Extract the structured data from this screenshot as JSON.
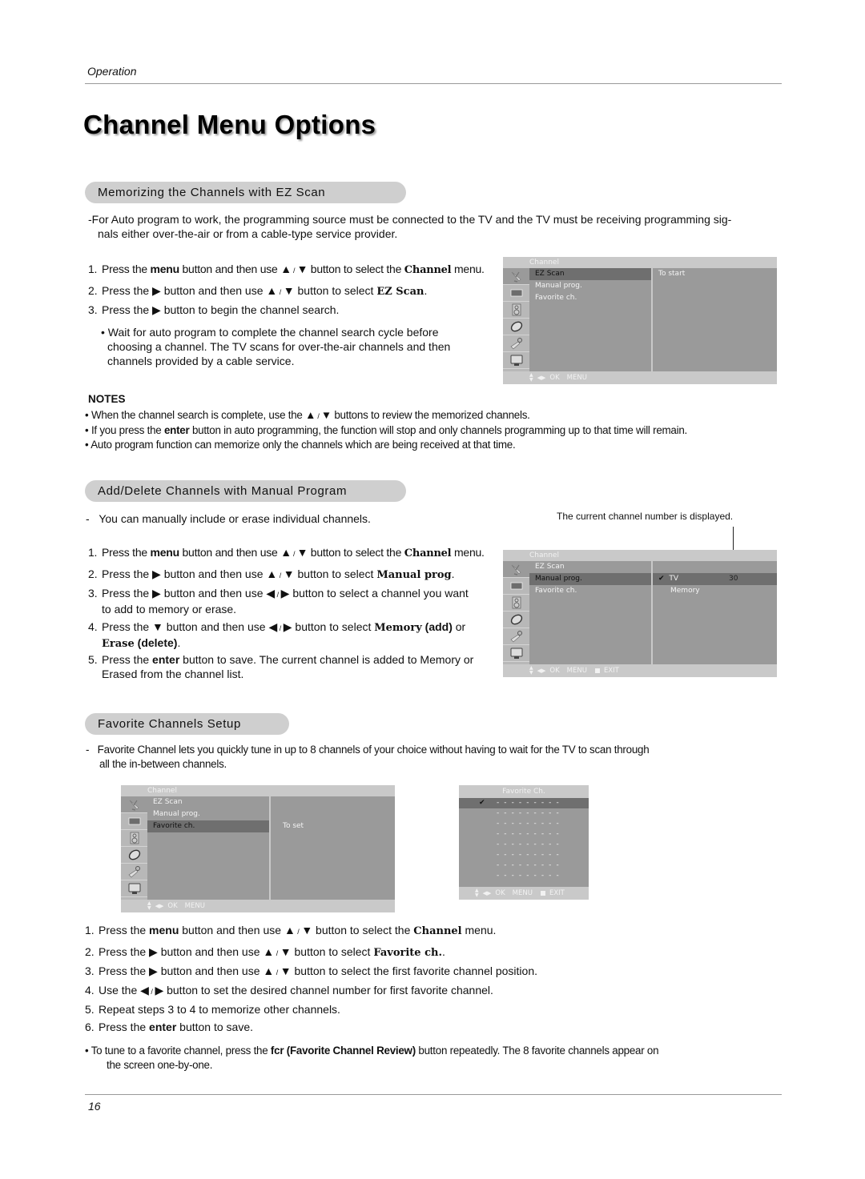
{
  "header": {
    "section_label": "Operation",
    "page_title": "Channel Menu Options"
  },
  "symbols": {
    "up": "▲",
    "down": "▼",
    "left": "◀",
    "right": "▶",
    "slash": " / ",
    "check": "✔",
    "bullet": "•",
    "dash": "-"
  },
  "ez_scan": {
    "heading": "Memorizing the Channels with EZ Scan",
    "intro": "For Auto program to work, the programming source must be connected to the TV and the TV must be receiving programming sig-",
    "intro_cont": "nals either over-the-air or from a cable-type service provider.",
    "steps": [
      {
        "num": "1.",
        "pre": "Press the ",
        "b1": "menu",
        "mid": " button and then use ",
        "post": " button to select the ",
        "b2": "Channel",
        "end": " menu."
      },
      {
        "num": "2.",
        "pre": "Press the ",
        "mid": " button and then use ",
        "post": " button to select ",
        "b2": "EZ Scan",
        "end": "."
      },
      {
        "num": "3.",
        "pre": "Press the ",
        "post": " button to begin the channel search."
      }
    ],
    "bullet": "Wait for auto program to complete the channel search cycle before choosing a channel. The TV scans for over-the-air channels and then channels provided by a cable service.",
    "osd": {
      "title": "Channel",
      "items": [
        "EZ Scan",
        "Manual prog.",
        "Favorite ch."
      ],
      "selected_index": 0,
      "sub_text": "To start",
      "footer": [
        "OK",
        "MENU"
      ]
    }
  },
  "notes": {
    "heading": "NOTES",
    "items": [
      {
        "pre": "When the channel search is complete, use the ",
        "post": " buttons to review the memorized channels."
      },
      {
        "pre": "If you press the ",
        "b": "enter",
        "post": " button in auto programming, the function will stop and only channels programming up to that time will remain."
      },
      {
        "pre": "Auto program function can memorize only the channels which are being received at that time."
      }
    ]
  },
  "manual_prog": {
    "heading": "Add/Delete Channels with Manual Program",
    "intro": "You can manually include or erase individual channels.",
    "callout": "The current channel number is displayed.",
    "steps": [
      {
        "num": "1.",
        "pre": "Press the ",
        "b1": "menu",
        "mid": " button and then use ",
        "post": " button to select the ",
        "b2": "Channel",
        "end": " menu."
      },
      {
        "num": "2.",
        "pre": "Press the ",
        "mid": " button and then use ",
        "post": " button to select ",
        "b2": "Manual prog",
        "end": "."
      },
      {
        "num": "3.",
        "pre": "Press the ",
        "mid": " button and then use ",
        "post": " button to select a channel you want",
        "cont": "to add to memory or erase."
      },
      {
        "num": "4.",
        "pre": "Press the ",
        "mid": " button and then use ",
        "post": " button to select ",
        "b2": "Memory",
        "b3": " (add)",
        "end": " or",
        "cont_b1": "Erase",
        "cont_b2": " (delete)",
        "cont_end": "."
      },
      {
        "num": "5.",
        "pre": "Press the ",
        "b1": "enter",
        "post": " button to save. The current channel is added to Memory or",
        "cont": "Erased from the channel list."
      }
    ],
    "osd": {
      "title": "Channel",
      "items": [
        "EZ Scan",
        "Manual prog.",
        "Favorite ch."
      ],
      "selected_index": 1,
      "sub_rows": [
        {
          "check": "✔",
          "label": "TV",
          "value": "30"
        },
        {
          "label": "Memory"
        }
      ],
      "footer": [
        "OK",
        "MENU",
        "EXIT"
      ]
    }
  },
  "favorite": {
    "heading": "Favorite Channels Setup",
    "intro": "Favorite Channel lets you quickly tune in up to 8 channels of your choice without having to wait for the TV to scan through",
    "intro_cont": "all the in-between channels.",
    "osd": {
      "title": "Channel",
      "items": [
        "EZ Scan",
        "Manual prog.",
        "Favorite ch."
      ],
      "selected_index": 2,
      "sub_text": "To set",
      "footer": [
        "OK",
        "MENU"
      ]
    },
    "fav_osd": {
      "title": "Favorite Ch.",
      "slots": [
        "- - - - - - - - -",
        "- - - - - - - - -",
        "- - - - - - - - -",
        "- - - - - - - - -",
        "- - - - - - - - -",
        "- - - - - - - - -",
        "- - - - - - - - -",
        "- - - - - - - - -"
      ],
      "selected_index": 0,
      "footer": [
        "OK",
        "MENU",
        "EXIT"
      ]
    },
    "steps": [
      {
        "num": "1.",
        "pre": "Press the ",
        "b1": "menu",
        "mid": " button and then use ",
        "post": "  button to select the ",
        "b2": "Channel",
        "end": " menu."
      },
      {
        "num": "2.",
        "pre": "Press the ",
        "mid": "  button and then use ",
        "post": " button to select ",
        "b2": "Favorite ch.",
        "end": "."
      },
      {
        "num": "3.",
        "pre": "Press the ",
        "mid": " button and then use ",
        "post": " button to select the first favorite channel position."
      },
      {
        "num": "4.",
        "pre": "Use the ",
        "post": " button to set the desired channel number for first favorite channel."
      },
      {
        "num": "5.",
        "pre": "Repeat steps 3 to 4 to memorize other channels."
      },
      {
        "num": "6.",
        "pre": "Press the ",
        "b1": "enter",
        "post": " button to save."
      }
    ],
    "bullet": {
      "pre": "To tune to a favorite channel, press the ",
      "b": "fcr (Favorite Channel Review)",
      "post": " button repeatedly. The 8 favorite channels appear on",
      "cont": "the screen one-by-one."
    }
  },
  "footer": {
    "page_number": "16"
  }
}
